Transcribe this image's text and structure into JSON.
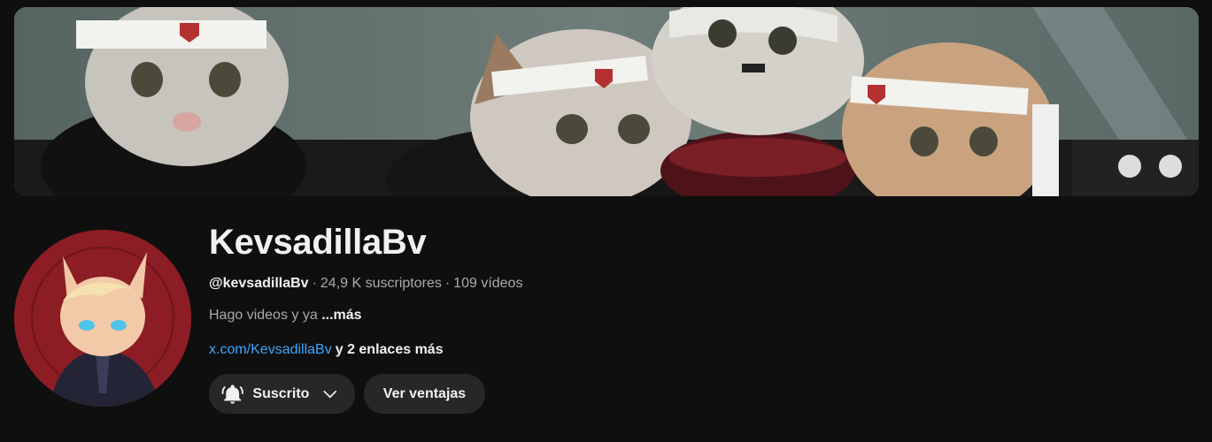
{
  "channel": {
    "name": "KevsadillaBv",
    "handle": "@kevsadillaBv",
    "subscribers": "24,9 K suscriptores",
    "videos": "109 vídeos",
    "separator": "·",
    "description": "Hago videos y ya",
    "more_label": "...más",
    "link_text": "x.com/KevsadillaBv",
    "extra_links": "y 2 enlaces más"
  },
  "actions": {
    "subscribed_label": "Suscrito",
    "perks_label": "Ver ventajas"
  },
  "icons": {
    "bell": "bell-ringing-icon",
    "chevron": "chevron-down-icon"
  },
  "colors": {
    "background": "#0f0f0f",
    "link": "#3ea6ff",
    "button_bg": "#272727",
    "secondary_text": "#aaaaaa"
  }
}
